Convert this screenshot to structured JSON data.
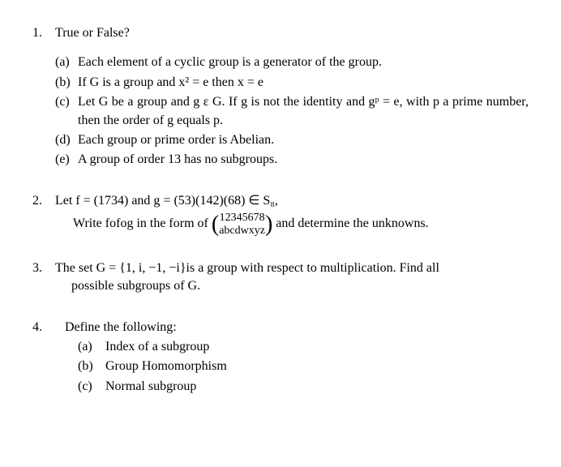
{
  "q1": {
    "number": "1.",
    "title": "True or False?",
    "items": [
      {
        "label": "(a)",
        "text": "Each element of a cyclic group is a generator of the group."
      },
      {
        "label": "(b)",
        "text": "If G is a group and x² = e then x = e"
      },
      {
        "label": "(c)",
        "text": "Let G be a group and g ε G. If g is not the identity and gᵖ = e, with p a prime number, then the order of g equals p."
      },
      {
        "label": "(d)",
        "text": "Each group or prime order is Abelian."
      },
      {
        "label": "(e)",
        "text": "A group of order 13 has no subgroups."
      }
    ]
  },
  "q2": {
    "number": "2.",
    "line1": "Let f = (1734) and g = (53)(142)(68) ∈ S₈,",
    "line2_pre": "Write fofog in the form of  ",
    "binom_top": "12345678",
    "binom_bottom": "abcdwxyz",
    "line2_post": "  and determine the unknowns."
  },
  "q3": {
    "number": "3.",
    "line1": "The set G = {1, i, −1, −i}is a group with respect to multiplication. Find all",
    "line2": "possible subgroups of  G."
  },
  "q4": {
    "number": "4.",
    "title": "Define the following:",
    "items": [
      {
        "label": "(a)",
        "text": "Index of a subgroup"
      },
      {
        "label": "(b)",
        "text": "Group Homomorphism"
      },
      {
        "label": "(c)",
        "text": "Normal subgroup"
      }
    ]
  }
}
